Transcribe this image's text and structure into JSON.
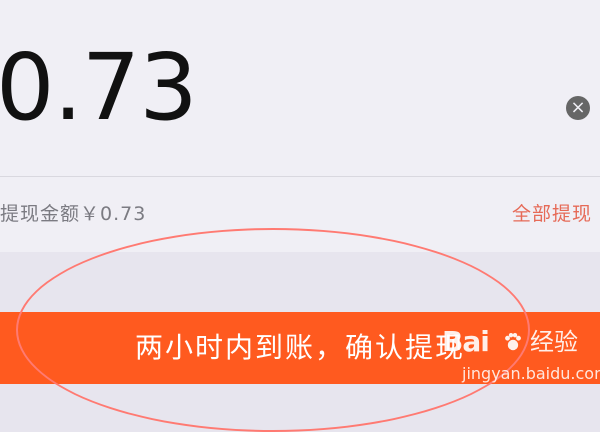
{
  "amount": "0.73",
  "available": "提现金额￥0.73",
  "withdraw_all_label": "全部提现",
  "confirm_label": "两小时内到账，确认提现",
  "clear_icon": "×",
  "watermark": {
    "brand": "Bai",
    "jingyan": "经验",
    "url": "jingyan.baidu.com"
  },
  "colors": {
    "accent": "#ff5a1f",
    "link": "#e66a57",
    "highlight": "#ff7a72",
    "background": "#e7e5ee"
  }
}
